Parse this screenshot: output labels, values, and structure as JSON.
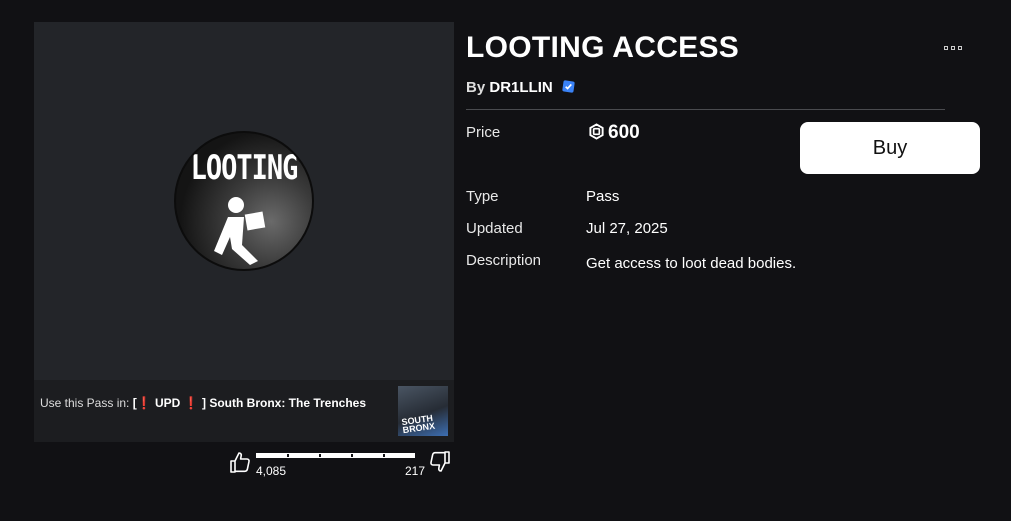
{
  "item": {
    "title": "LOOTING ACCESS",
    "by_prefix": "By",
    "creator": "DR1LLIN",
    "thumbnail_text": "LOOTING"
  },
  "details": {
    "price_label": "Price",
    "price_value": "600",
    "type_label": "Type",
    "type_value": "Pass",
    "updated_label": "Updated",
    "updated_value": "Jul 27, 2025",
    "description_label": "Description",
    "description_value": "Get access to loot dead bodies."
  },
  "buy_label": "Buy",
  "experience": {
    "prefix": "Use this Pass in:",
    "open_bracket": "[",
    "mark_1": "❗",
    "upd": "UPD",
    "mark_2": "❗",
    "rest": "] South Bronx: The Trenches",
    "thumb_text_line1": "SOUTH",
    "thumb_text_line2": "BRONX"
  },
  "votes": {
    "up": "4,085",
    "down": "217",
    "up_ratio": 0.95
  },
  "colors": {
    "background": "#111114",
    "panel": "#232529",
    "verified": "#3a82f6",
    "buy_button": "#ffffff"
  },
  "icons": [
    "robux-icon",
    "verified-badge-icon",
    "thumbs-up-icon",
    "thumbs-down-icon",
    "more-options-icon"
  ]
}
